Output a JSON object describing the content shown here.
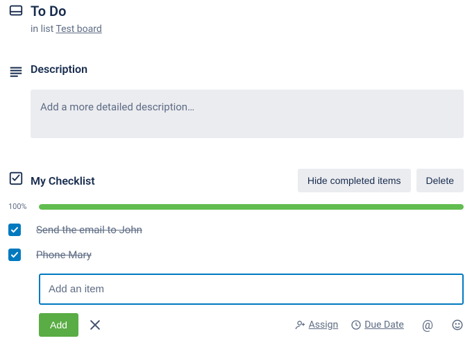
{
  "card": {
    "title": "To Do",
    "in_list_prefix": "in list ",
    "list_name": "Test board"
  },
  "description": {
    "heading": "Description",
    "placeholder": "Add a more detailed description…"
  },
  "checklist": {
    "title": "My Checklist",
    "hide_label": "Hide completed items",
    "delete_label": "Delete",
    "progress_pct": "100%",
    "progress_value": 100,
    "items": [
      {
        "text": "Send the email to John",
        "checked": true
      },
      {
        "text": "Phone Mary",
        "checked": true
      }
    ],
    "add_item_placeholder": "Add an item",
    "add_button": "Add",
    "assign_label": "Assign",
    "due_date_label": "Due Date"
  },
  "colors": {
    "accent_blue": "#0079bf",
    "green": "#61bd4f",
    "add_green": "#5aac44",
    "gray_bg": "#ebecf0"
  }
}
